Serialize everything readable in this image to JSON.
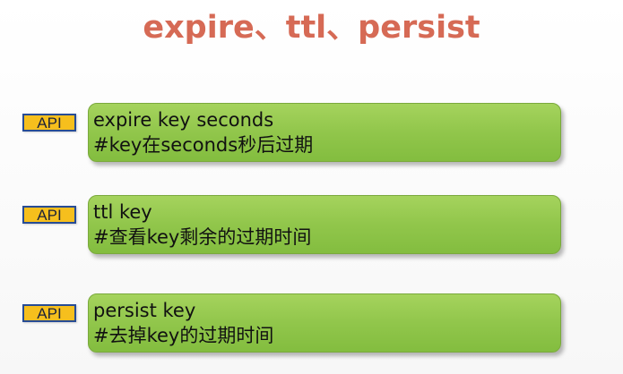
{
  "slide": {
    "title": "expire、ttl、persist",
    "items": [
      {
        "badge": "API",
        "command": "expire key seconds",
        "comment": "#key在seconds秒后过期"
      },
      {
        "badge": "API",
        "command": "ttl key",
        "comment": "#查看key剩余的过期时间"
      },
      {
        "badge": "API",
        "command": "persist key",
        "comment": "#去掉key的过期时间"
      }
    ]
  },
  "colors": {
    "title": "#d66a55",
    "card_green": "#91c64b",
    "badge_yellow": "#f6bf1d",
    "badge_border": "#274c95"
  }
}
